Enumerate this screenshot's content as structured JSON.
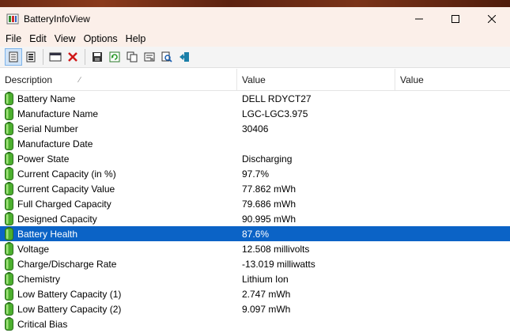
{
  "window": {
    "title": "BatteryInfoView",
    "controls": [
      "minimize-icon",
      "maximize-icon",
      "close-icon"
    ]
  },
  "menu": {
    "items": [
      {
        "label": "File"
      },
      {
        "label": "Edit"
      },
      {
        "label": "View"
      },
      {
        "label": "Options"
      },
      {
        "label": "Help"
      }
    ]
  },
  "toolbar": {
    "buttons": [
      "battery-info-view-icon",
      "log-view-icon",
      "options-icon",
      "clear-icon",
      "save-icon",
      "refresh-icon",
      "copy-icon",
      "properties-icon",
      "find-icon",
      "exit-icon"
    ]
  },
  "columns": {
    "description": "Description",
    "value": "Value",
    "value2": "Value"
  },
  "rows": [
    {
      "name": "Battery Name",
      "value": "DELL RDYCT27"
    },
    {
      "name": "Manufacture Name",
      "value": "LGC-LGC3.975"
    },
    {
      "name": "Serial Number",
      "value": "30406"
    },
    {
      "name": "Manufacture Date",
      "value": ""
    },
    {
      "name": "Power State",
      "value": "Discharging"
    },
    {
      "name": "Current Capacity (in %)",
      "value": "97.7%"
    },
    {
      "name": "Current Capacity Value",
      "value": "77.862 mWh"
    },
    {
      "name": "Full Charged Capacity",
      "value": "79.686 mWh"
    },
    {
      "name": "Designed Capacity",
      "value": "90.995 mWh"
    },
    {
      "name": "Battery Health",
      "value": "87.6%"
    },
    {
      "name": "Voltage",
      "value": "12.508 millivolts"
    },
    {
      "name": "Charge/Discharge Rate",
      "value": "-13.019 milliwatts"
    },
    {
      "name": "Chemistry",
      "value": "Lithium Ion"
    },
    {
      "name": "Low Battery Capacity (1)",
      "value": "2.747 mWh"
    },
    {
      "name": "Low Battery Capacity (2)",
      "value": "9.097 mWh"
    },
    {
      "name": "Critical Bias",
      "value": ""
    }
  ],
  "selected_row": "Battery Health",
  "colors": {
    "selection": "#0b63c6",
    "titlebar": "#fbefe9",
    "battery_green": "#3f9a2c"
  }
}
